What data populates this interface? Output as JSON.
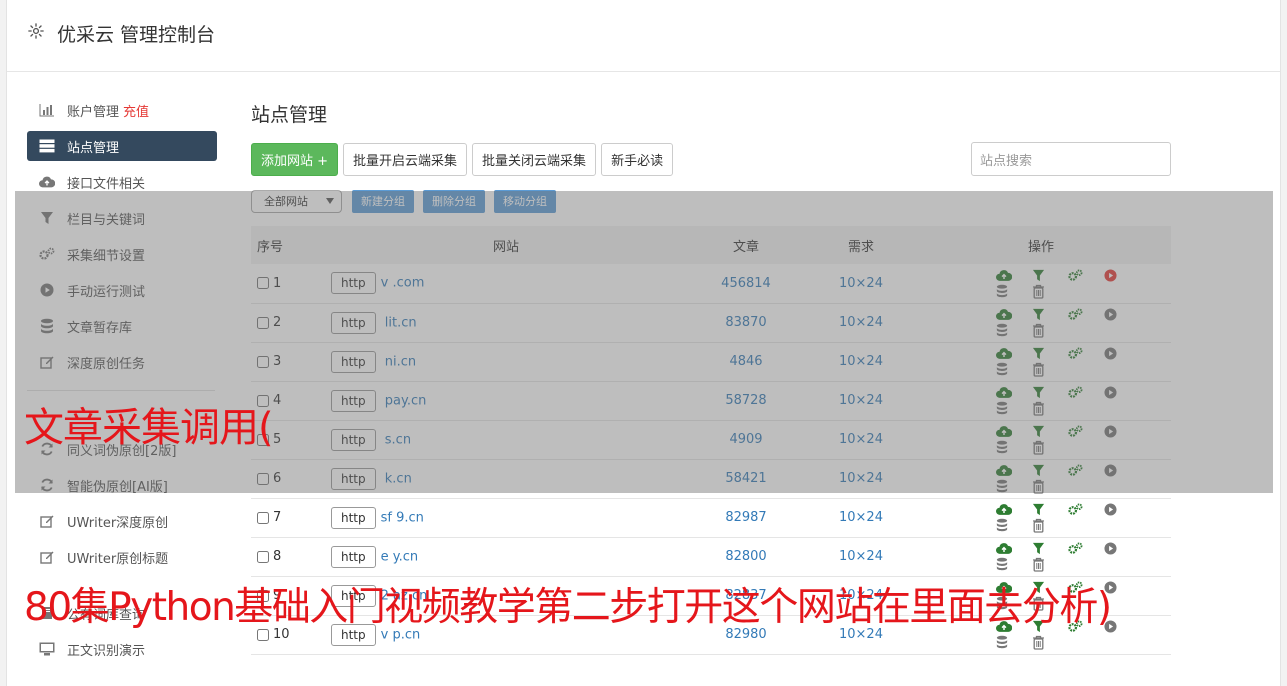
{
  "header": {
    "title": "优采云 管理控制台"
  },
  "sidebar": {
    "items": [
      {
        "label": "账户管理",
        "extra": "充值",
        "icon": "bar-chart-icon"
      },
      {
        "label": "站点管理",
        "icon": "server-icon",
        "active": true
      },
      {
        "label": "接口文件相关",
        "icon": "cloud-upload-icon"
      },
      {
        "label": "栏目与关键词",
        "icon": "filter-icon"
      },
      {
        "label": "采集细节设置",
        "icon": "cogs-icon"
      },
      {
        "label": "手动运行测试",
        "icon": "play-icon"
      },
      {
        "label": "文章暂存库",
        "icon": "database-icon"
      },
      {
        "label": "深度原创任务",
        "icon": "edit-icon"
      }
    ],
    "items2": [
      {
        "label": "同义词伪原创[2版]",
        "icon": "refresh-icon"
      },
      {
        "label": "智能伪原创[AI版]",
        "icon": "refresh-icon"
      },
      {
        "label": "UWriter深度原创",
        "icon": "edit-icon"
      },
      {
        "label": "UWriter原创标题",
        "icon": "edit-icon"
      },
      {
        "label": "公有词库查询",
        "icon": "book-icon"
      },
      {
        "label": "正文识别演示",
        "icon": "monitor-icon"
      }
    ]
  },
  "main": {
    "title": "站点管理",
    "toolbar": {
      "add": "添加网站 +",
      "batch_open": "批量开启云端采集",
      "batch_close": "批量关闭云端采集",
      "newbie": "新手必读",
      "search_placeholder": "站点搜索"
    },
    "group": {
      "select": "全部网站",
      "new_group": "新建分组",
      "delete_group": "删除分组",
      "move_group": "移动分组"
    },
    "table": {
      "headers": [
        "序号",
        "网站",
        "文章",
        "需求",
        "操作"
      ],
      "rows": [
        {
          "idx": "1",
          "proto": "http",
          "site": "v        .com",
          "articles": "456814",
          "req": "10×24",
          "running": true
        },
        {
          "idx": "2",
          "proto": "http",
          "site": "     lit.cn",
          "articles": "83870",
          "req": "10×24"
        },
        {
          "idx": "3",
          "proto": "http",
          "site": "     ni.cn",
          "articles": "4846",
          "req": "10×24"
        },
        {
          "idx": "4",
          "proto": "http",
          "site": "     pay.cn",
          "articles": "58728",
          "req": "10×24"
        },
        {
          "idx": "5",
          "proto": "http",
          "site": "     s.cn",
          "articles": "4909",
          "req": "10×24"
        },
        {
          "idx": "6",
          "proto": "http",
          "site": "     k.cn",
          "articles": "58421",
          "req": "10×24"
        },
        {
          "idx": "7",
          "proto": "http",
          "site": "sf  9.cn",
          "articles": "82987",
          "req": "10×24"
        },
        {
          "idx": "8",
          "proto": "http",
          "site": "e     y.cn",
          "articles": "82800",
          "req": "10×24"
        },
        {
          "idx": "9",
          "proto": "http",
          "site": "2    az.cn",
          "articles": "82837",
          "req": "10×24"
        },
        {
          "idx": "10",
          "proto": "http",
          "site": "v    p.cn",
          "articles": "82980",
          "req": "10×24"
        }
      ]
    }
  },
  "captions": {
    "line1": "文章采集调用(",
    "line2": "80集Python基础入门视频教学第二步打开这个网站在里面去分析)"
  },
  "colors": {
    "accent_green": "#5cb85c",
    "sidebar_active": "#34495e",
    "link": "#337ab7",
    "caption": "#e5161b",
    "op_green": "#2e7d32",
    "op_red": "#e53935",
    "op_gray": "#777777"
  }
}
